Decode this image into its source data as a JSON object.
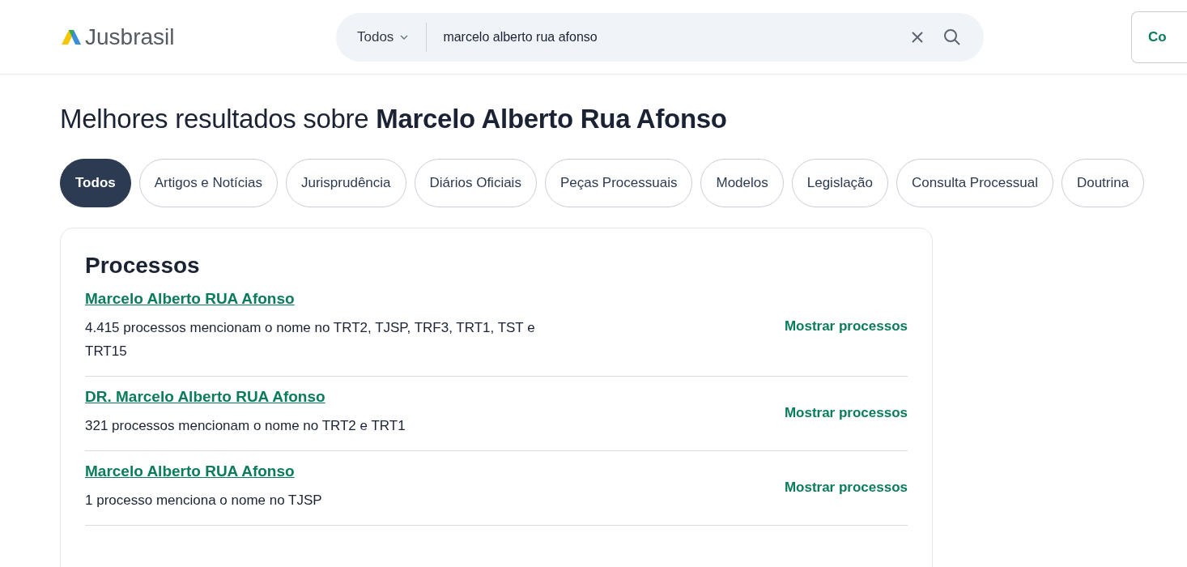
{
  "header": {
    "logo": "Jusbrasil",
    "search": {
      "scope": "Todos",
      "value": "marcelo alberto rua afonso"
    },
    "button": "Co"
  },
  "heading": "Melhores resultados sobre **Marcelo Alberto Rua Afonso**",
  "filters": [
    {
      "label": "Todos",
      "selected": true
    },
    {
      "label": "Artigos e Notícias",
      "selected": false
    },
    {
      "label": "Jurisprudência",
      "selected": false
    },
    {
      "label": "Diários Oficiais",
      "selected": false
    },
    {
      "label": "Peças Processuais",
      "selected": false
    },
    {
      "label": "Modelos",
      "selected": false
    },
    {
      "label": "Legislação",
      "selected": false
    },
    {
      "label": "Consulta Processual",
      "selected": false
    },
    {
      "label": "Doutrina",
      "selected": false
    }
  ],
  "card": {
    "title": "Processos",
    "rows": [
      {
        "name": "Marcelo Alberto RUA Afonso",
        "description": "4.415 processos mencionam o nome no TRT2, TJSP, TRF3, TRT1, TST e TRT15",
        "action": "Mostrar processos"
      },
      {
        "name": "DR. Marcelo Alberto RUA Afonso",
        "description": "321 processos mencionam o nome no TRT2 e TRT1",
        "action": "Mostrar processos"
      },
      {
        "name": "Marcelo Alberto RUA Afonso",
        "description": "1 processo menciona o nome no TJSP",
        "action": "Mostrar processos"
      }
    ]
  }
}
